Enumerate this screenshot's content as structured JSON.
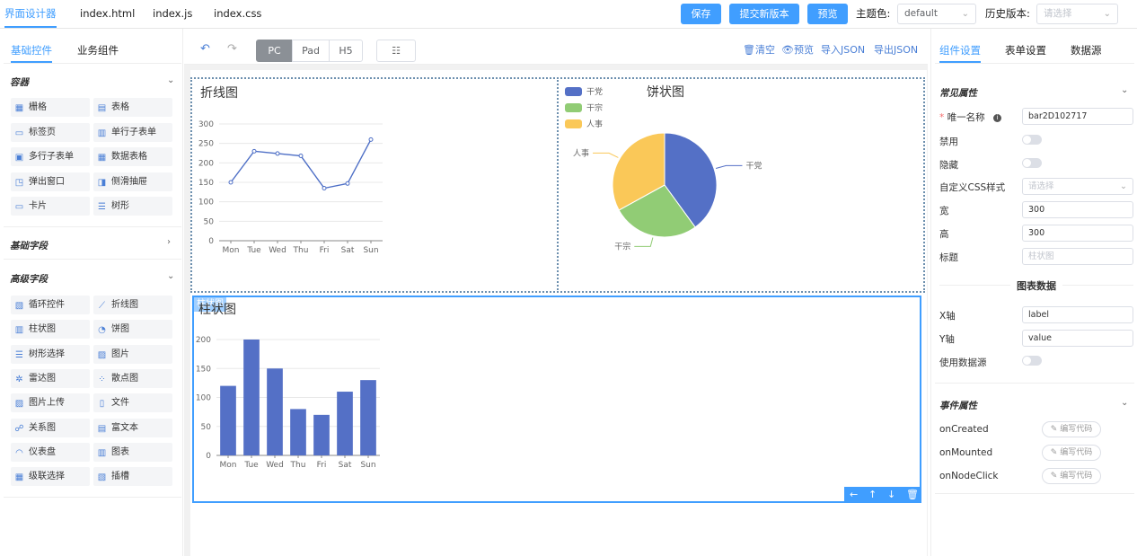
{
  "topbar": {
    "tabs": [
      "界面设计器",
      "index.html",
      "index.js",
      "index.css"
    ],
    "buttons": {
      "save": "保存",
      "submit": "提交新版本",
      "preview": "预览"
    },
    "theme_label": "主题色:",
    "theme_value": "default",
    "history_label": "历史版本:",
    "history_placeholder": "请选择"
  },
  "left": {
    "tabs": [
      "基础控件",
      "业务组件"
    ],
    "sections": {
      "container": "容器",
      "basic": "基础字段",
      "advanced": "高级字段"
    },
    "container_items": [
      {
        "label": "栅格",
        "icon": "grid-icon"
      },
      {
        "label": "表格",
        "icon": "table-icon"
      },
      {
        "label": "标签页",
        "icon": "folder-tab-icon"
      },
      {
        "label": "单行子表单",
        "icon": "subform-icon"
      },
      {
        "label": "多行子表单",
        "icon": "multi-subform-icon"
      },
      {
        "label": "数据表格",
        "icon": "data-table-icon"
      },
      {
        "label": "弹出窗口",
        "icon": "popup-window-icon"
      },
      {
        "label": "侧滑抽屉",
        "icon": "drawer-icon"
      },
      {
        "label": "卡片",
        "icon": "card-icon"
      },
      {
        "label": "树形",
        "icon": "tree-icon"
      }
    ],
    "advanced_items": [
      {
        "label": "循环控件",
        "icon": "loop-icon"
      },
      {
        "label": "折线图",
        "icon": "line-chart-icon"
      },
      {
        "label": "柱状图",
        "icon": "bar-chart-icon"
      },
      {
        "label": "饼图",
        "icon": "pie-chart-icon"
      },
      {
        "label": "树形选择",
        "icon": "tree-select-icon"
      },
      {
        "label": "图片",
        "icon": "image-icon"
      },
      {
        "label": "雷达图",
        "icon": "radar-chart-icon"
      },
      {
        "label": "散点图",
        "icon": "scatter-chart-icon"
      },
      {
        "label": "图片上传",
        "icon": "image-upload-icon"
      },
      {
        "label": "文件",
        "icon": "file-icon"
      },
      {
        "label": "关系图",
        "icon": "relation-graph-icon"
      },
      {
        "label": "富文本",
        "icon": "rich-text-icon"
      },
      {
        "label": "仪表盘",
        "icon": "gauge-icon"
      },
      {
        "label": "图表",
        "icon": "chart-icon"
      },
      {
        "label": "级联选择",
        "icon": "cascader-icon"
      },
      {
        "label": "插槽",
        "icon": "slot-icon"
      }
    ]
  },
  "toolbar": {
    "devices": [
      "PC",
      "Pad",
      "H5"
    ],
    "active_device": "PC",
    "actions": {
      "clear": "清空",
      "preview": "预览",
      "import": "导入JSON",
      "export": "导出JSON"
    }
  },
  "canvas": {
    "widget_tag": "柱状图",
    "line_title": "折线图",
    "pie_title": "饼状图",
    "bar_title": "柱状图"
  },
  "chart_data": [
    {
      "type": "line",
      "title": "折线图",
      "x": [
        "Mon",
        "Tue",
        "Wed",
        "Thu",
        "Fri",
        "Sat",
        "Sun"
      ],
      "series": [
        {
          "values": [
            150,
            230,
            224,
            218,
            135,
            147,
            260
          ]
        }
      ],
      "yticks": [
        "0",
        "50",
        "100",
        "150",
        "200",
        "250",
        "300"
      ],
      "ylim": [
        0,
        300
      ],
      "grid": true,
      "color": "#4e6fc6"
    },
    {
      "type": "pie",
      "title": "饼状图",
      "legend": "top-left",
      "slices": [
        {
          "name": "干党",
          "value": 40,
          "color": "#5470c6"
        },
        {
          "name": "干宗",
          "value": 27,
          "color": "#91cc75"
        },
        {
          "name": "人事",
          "value": 33,
          "color": "#fac858"
        }
      ]
    },
    {
      "type": "bar",
      "title": "柱状图",
      "categories": [
        "Mon",
        "Tue",
        "Wed",
        "Thu",
        "Fri",
        "Sat",
        "Sun"
      ],
      "values": [
        120,
        200,
        150,
        80,
        70,
        110,
        130
      ],
      "yticks": [
        "0",
        "50",
        "100",
        "150",
        "200"
      ],
      "ylim": [
        0,
        200
      ],
      "grid": true,
      "color": "#5470c6"
    }
  ],
  "right": {
    "tabs": [
      "组件设置",
      "表单设置",
      "数据源"
    ],
    "common_section": "常见属性",
    "fields": {
      "unique_name": {
        "label": "唯一名称",
        "value": "bar2D102717"
      },
      "disabled": {
        "label": "禁用"
      },
      "hidden": {
        "label": "隐藏"
      },
      "css": {
        "label": "自定义CSS样式",
        "placeholder": "请选择"
      },
      "width": {
        "label": "宽",
        "value": "300"
      },
      "height": {
        "label": "高",
        "value": "300"
      },
      "title": {
        "label": "标题",
        "placeholder": "柱状图"
      }
    },
    "chart_data_header": "图表数据",
    "data_fields": {
      "x": {
        "label": "X轴",
        "value": "label"
      },
      "y": {
        "label": "Y轴",
        "value": "value"
      },
      "use_source": {
        "label": "使用数据源"
      }
    },
    "event_section": "事件属性",
    "events": [
      {
        "label": "onCreated",
        "button": "编写代码"
      },
      {
        "label": "onMounted",
        "button": "编写代码"
      },
      {
        "label": "onNodeClick",
        "button": "编写代码"
      }
    ]
  }
}
